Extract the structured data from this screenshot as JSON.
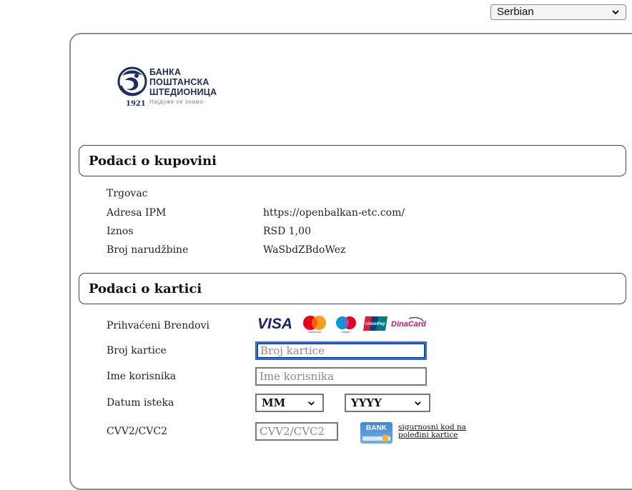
{
  "language": {
    "selected": "Serbian"
  },
  "bank": {
    "name_lines": [
      "БАНКА",
      "ПОШТАНСКА",
      "ШТЕДИОНИЦА"
    ],
    "tagline": "Најдуже се знамо",
    "year": "1921"
  },
  "purchase": {
    "title": "Podaci o kupovini",
    "rows": [
      {
        "label": "Trgovac",
        "value": ""
      },
      {
        "label": "Adresa IPM",
        "value": "https://openbalkan-etc.com/"
      },
      {
        "label": "Iznos",
        "value": "RSD 1,00"
      },
      {
        "label": "Broj narudžbine",
        "value": "WaSbdZBdoWez"
      }
    ]
  },
  "card": {
    "title": "Podaci o kartici",
    "brands_label": "Prihvaćeni Brendovi",
    "brands": [
      "VISA",
      "mastercard",
      "maestro",
      "UnionPay",
      "DinaCard"
    ],
    "number_label": "Broj kartice",
    "number_placeholder": "Broj kartice",
    "name_label": "Ime korisnika",
    "name_placeholder": "Ime korisnika",
    "expiry_label": "Datum isteka",
    "month_value": "MM",
    "year_value": "YYYY",
    "cvv_label": "CVV2/CVC2",
    "cvv_placeholder": "CVV2/CVC2",
    "bank_badge": "BANK",
    "cvv_hint": "sigurnosni kod na poleđini kartice"
  },
  "colors": {
    "focus": "#2a6fd6",
    "brand_navy": "#1d2d5c"
  }
}
